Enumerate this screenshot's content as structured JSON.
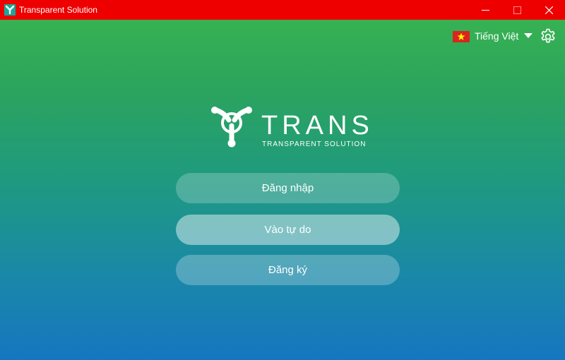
{
  "window": {
    "title": "Transparent Solution",
    "titlebar_color": "#ee0000"
  },
  "window_controls": {
    "minimize_icon": "minimize-icon",
    "maximize_icon": "maximize-icon",
    "close_icon": "close-icon"
  },
  "language": {
    "flag_icon": "vietnam-flag-icon",
    "label": "Tiếng Việt",
    "dropdown_icon": "caret-down-icon"
  },
  "settings": {
    "icon": "gear-icon"
  },
  "logo": {
    "wordmark": "TRANS",
    "tagline": "TRANSPARENT SOLUTION"
  },
  "actions": {
    "login_label": "Đăng nhập",
    "guest_label": "Vào tự do",
    "register_label": "Đăng ký"
  },
  "colors": {
    "gradient_top": "#3bb54f",
    "gradient_bottom": "#1676c0",
    "flag_red": "#da251d",
    "flag_star": "#ffff00"
  }
}
